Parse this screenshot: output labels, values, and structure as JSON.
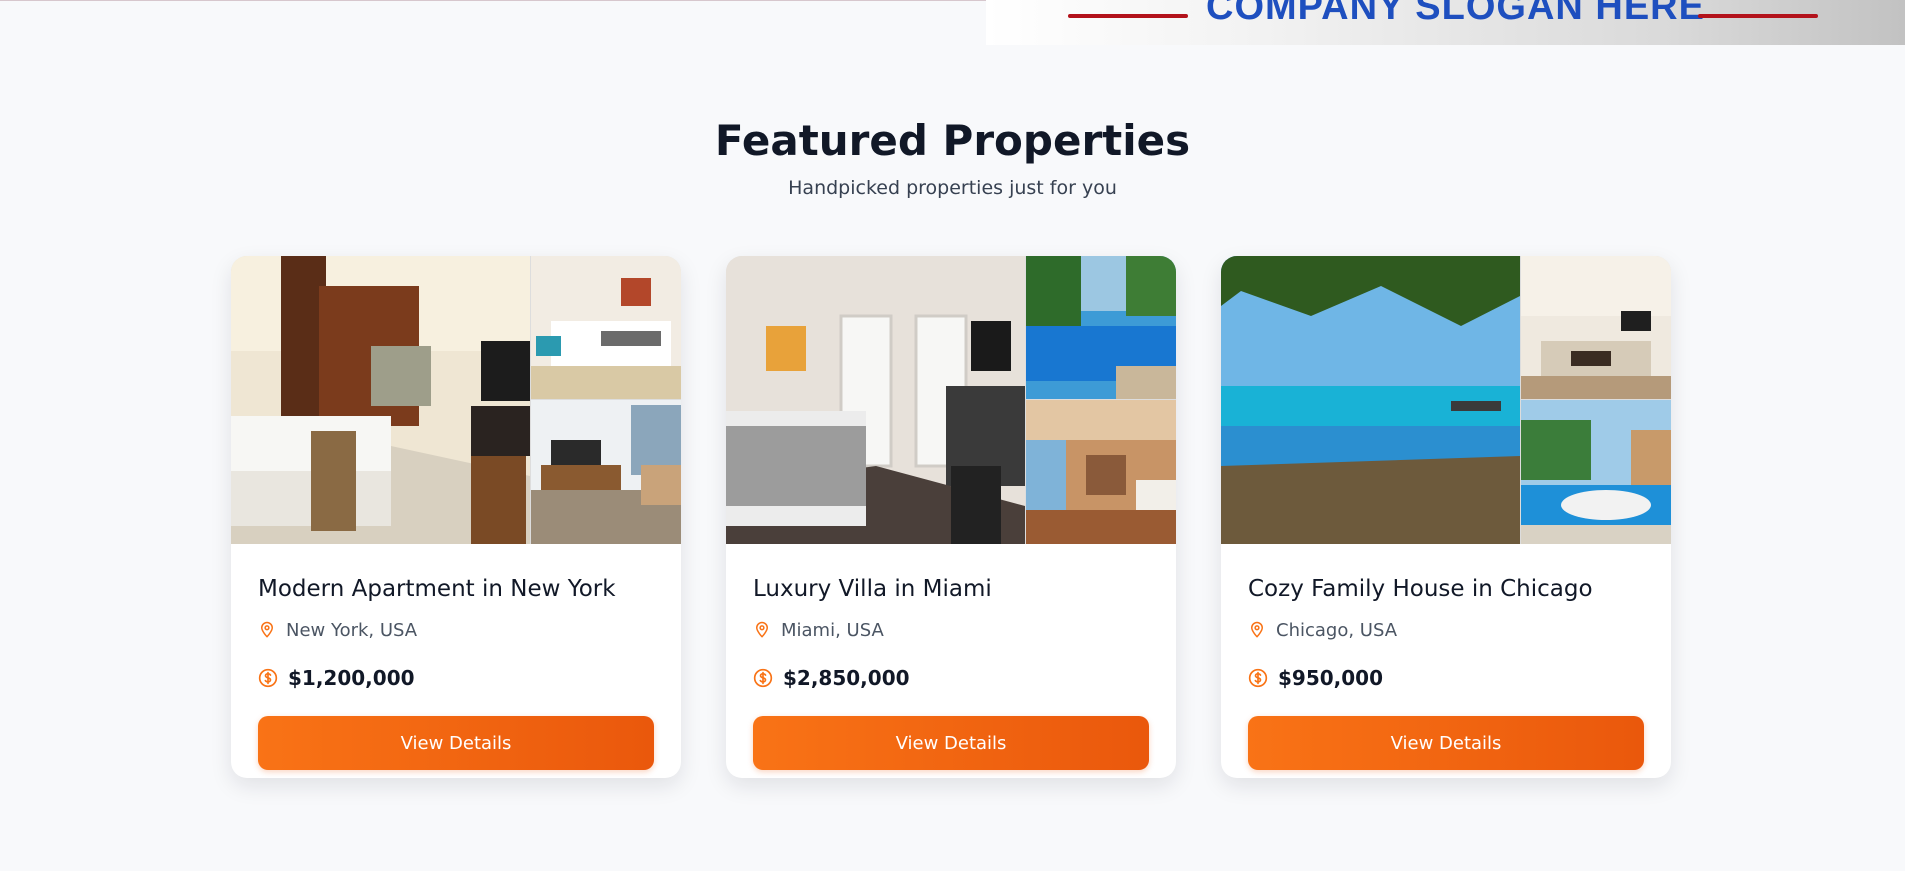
{
  "banner": {
    "slogan": "COMPANY SLOGAN HERE"
  },
  "section": {
    "title": "Featured Properties",
    "subtitle": "Handpicked properties just for you"
  },
  "accent_color": "#f97316",
  "properties": [
    {
      "title": "Modern Apartment in New York",
      "location": "New York, USA",
      "price": "$1,200,000",
      "button_label": "View Details"
    },
    {
      "title": "Luxury Villa in Miami",
      "location": "Miami, USA",
      "price": "$2,850,000",
      "button_label": "View Details"
    },
    {
      "title": "Cozy Family House in Chicago",
      "location": "Chicago, USA",
      "price": "$950,000",
      "button_label": "View Details"
    }
  ],
  "icons": {
    "location": "map-pin-icon",
    "price": "dollar-circle-icon",
    "accessibility": "wheelchair-icon"
  }
}
